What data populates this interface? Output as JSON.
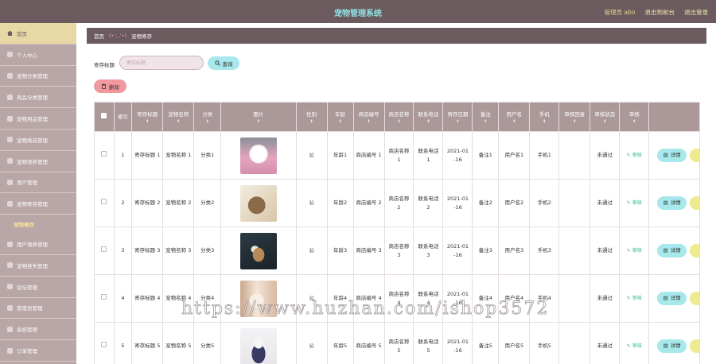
{
  "header": {
    "title": "宠物管理系统",
    "admin_label": "管理员 abo",
    "frontend_link": "退出到前台",
    "logout_link": "退出登录"
  },
  "sidebar": {
    "items": [
      {
        "label": "首页"
      },
      {
        "label": "个人中心"
      },
      {
        "label": "宠物分类管理"
      },
      {
        "label": "商品分类管理"
      },
      {
        "label": "宠物用品管理"
      },
      {
        "label": "宠物商店管理"
      },
      {
        "label": "宠物领养管理"
      },
      {
        "label": "用户管理"
      },
      {
        "label": "宠物寄存管理"
      },
      {
        "label": "宠物寄存"
      },
      {
        "label": "用户领养管理"
      },
      {
        "label": "宠物挂失管理"
      },
      {
        "label": "论坛管理"
      },
      {
        "label": "管理员管理"
      },
      {
        "label": "系统管理"
      },
      {
        "label": "订单管理"
      }
    ]
  },
  "breadcrumb": {
    "home": "首页",
    "emoticon": "(•'◡'•)",
    "current": "宠物寄存"
  },
  "search": {
    "label": "寄存标题",
    "placeholder": "寄存标题",
    "query_label": "查询"
  },
  "actions": {
    "delete_label": "删除"
  },
  "table": {
    "columns": [
      "索引",
      "寄存标题",
      "宠物名称",
      "分类",
      "图片",
      "性别",
      "年龄",
      "商店编号",
      "商店名称",
      "联系电话",
      "寄存日期",
      "备注",
      "用户名",
      "手机",
      "审核回复",
      "审核状态",
      "审核"
    ],
    "rows": [
      {
        "index": "1",
        "title": "寄存标题 1",
        "pet_name": "宠物名称 1",
        "category": "分类1",
        "image": "pet-white-dog",
        "gender": "公",
        "age": "年龄1",
        "shop_no": "商店编号 1",
        "shop_name": "商店名称 1",
        "phone": "联系电话 1",
        "date": "2021-01 -16",
        "remark": "备注1",
        "username": "用户名1",
        "mobile": "手机1",
        "reply": "",
        "status": "未通过",
        "audit": "审核",
        "detail": "详情"
      },
      {
        "index": "2",
        "title": "寄存标题 2",
        "pet_name": "宠物名称 2",
        "category": "分类2",
        "image": "pet-tabby-cat",
        "gender": "公",
        "age": "年龄2",
        "shop_no": "商店编号 2",
        "shop_name": "商店名称 2",
        "phone": "联系电话 2",
        "date": "2021-01 -16",
        "remark": "备注2",
        "username": "用户名2",
        "mobile": "手机2",
        "reply": "",
        "status": "未通过",
        "audit": "审核",
        "detail": "详情"
      },
      {
        "index": "3",
        "title": "寄存标题 3",
        "pet_name": "宠物名称 3",
        "category": "分类3",
        "image": "pet-puppy-dark",
        "gender": "公",
        "age": "年龄3",
        "shop_no": "商店编号 3",
        "shop_name": "商店名称 3",
        "phone": "联系电话 3",
        "date": "2021-01 -16",
        "remark": "备注3",
        "username": "用户名3",
        "mobile": "手机3",
        "reply": "",
        "status": "未通过",
        "audit": "审核",
        "detail": "详情"
      },
      {
        "index": "4",
        "title": "寄存标题 4",
        "pet_name": "宠物名称 4",
        "category": "分类4",
        "image": "pet-cat-curtain",
        "gender": "公",
        "age": "年龄4",
        "shop_no": "商店编号 4",
        "shop_name": "商店名称 4",
        "phone": "联系电话 4",
        "date": "2021-01 -16",
        "remark": "备注4",
        "username": "用户名4",
        "mobile": "手机4",
        "reply": "",
        "status": "未通过",
        "audit": "审核",
        "detail": "详情"
      },
      {
        "index": "5",
        "title": "寄存标题 5",
        "pet_name": "宠物名称 5",
        "category": "分类5",
        "image": "pet-dog-sweater",
        "gender": "公",
        "age": "年龄5",
        "shop_no": "商店编号 5",
        "shop_name": "商店名称 5",
        "phone": "联系电话 5",
        "date": "2021-01 -16",
        "remark": "备注5",
        "username": "用户名5",
        "mobile": "手机5",
        "reply": "",
        "status": "未通过",
        "audit": "审核",
        "detail": "详情"
      }
    ]
  },
  "watermark": "https://www.huzhan.com/ishop3572",
  "colors": {
    "header_bg": "#6b5a5e",
    "title": "#8fe3e6",
    "sidebar_bg": "#b9a6a6",
    "home_item": "#e7d8a6",
    "active_sub": "#f7e39a",
    "table_head": "#ab9899",
    "query_btn": "#a7e8ec",
    "delete_btn": "#f09aa0",
    "audit_text": "#3cb39a"
  }
}
